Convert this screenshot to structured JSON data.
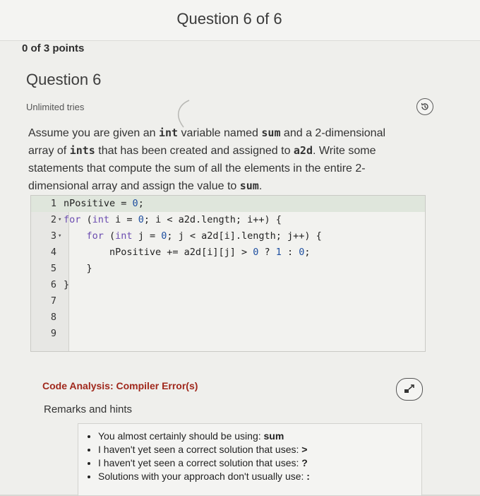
{
  "header": {
    "title": "Question 6 of 6"
  },
  "score": {
    "points_text": "0 of 3 points"
  },
  "question": {
    "heading": "Question 6",
    "tries": "Unlimited tries",
    "prompt": {
      "p1": "Assume you are given an ",
      "t1": "int",
      "p2": " variable named ",
      "t2": "sum",
      "p3": " and a 2-dimensional array of ",
      "t3": "ints",
      "p4": " that has been created and assigned to ",
      "t4": "a2d",
      "p5": ". Write some statements that compute the sum of all the elements in the entire 2-dimensional array and assign the value to ",
      "t5": "sum",
      "p6": "."
    }
  },
  "editor": {
    "lines": [
      {
        "n": "1",
        "fold": "",
        "code": "nPositive = 0;"
      },
      {
        "n": "2",
        "fold": "▾",
        "code": "for (int i = 0; i < a2d.length; i++) {"
      },
      {
        "n": "3",
        "fold": "▾",
        "code": "    for (int j = 0; j < a2d[i].length; j++) {"
      },
      {
        "n": "4",
        "fold": "",
        "code": "        nPositive += a2d[i][j] > 0 ? 1 : 0;"
      },
      {
        "n": "5",
        "fold": "",
        "code": "    }"
      },
      {
        "n": "6",
        "fold": "",
        "code": "}"
      },
      {
        "n": "7",
        "fold": "",
        "code": ""
      },
      {
        "n": "8",
        "fold": "",
        "code": ""
      },
      {
        "n": "9",
        "fold": "",
        "code": ""
      }
    ]
  },
  "analysis": {
    "status": "Code Analysis: Compiler Error(s)"
  },
  "remarks": {
    "heading": "Remarks and hints",
    "items": [
      {
        "text": "You almost certainly should be using: ",
        "bold": "sum"
      },
      {
        "text": "I haven't yet seen a correct solution that uses: ",
        "bold": ">"
      },
      {
        "text": "I haven't yet seen a correct solution that uses: ",
        "bold": "?"
      },
      {
        "text": "Solutions with your approach don't usually use: ",
        "bold": ":"
      }
    ]
  },
  "icons": {
    "history": "history-icon",
    "expand": "expand-icon"
  }
}
